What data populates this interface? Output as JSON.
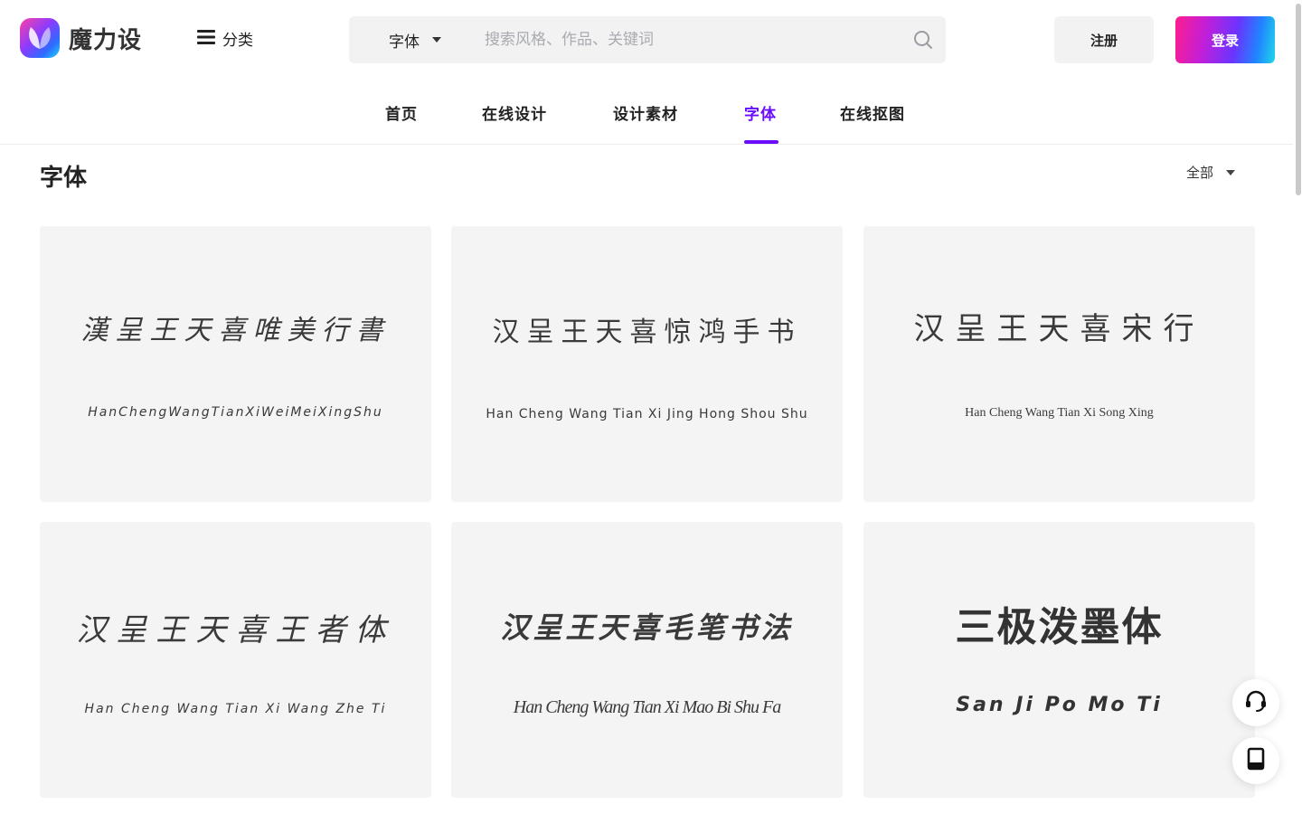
{
  "brand": {
    "name": "魔力设"
  },
  "header": {
    "category_label": "分类",
    "search": {
      "type_label": "字体",
      "placeholder": "搜索风格、作品、关键词"
    },
    "register_label": "注册",
    "login_label": "登录"
  },
  "nav": {
    "items": [
      {
        "label": "首页"
      },
      {
        "label": "在线设计"
      },
      {
        "label": "设计素材"
      },
      {
        "label": "字体",
        "active": true
      },
      {
        "label": "在线抠图"
      }
    ]
  },
  "page": {
    "title": "字体",
    "filter_label": "全部"
  },
  "fonts": [
    {
      "sample": "漢呈王天喜唯美行書",
      "name": "HanChengWangTianXiWeiMeiXingShu"
    },
    {
      "sample": "汉呈王天喜惊鸿手书",
      "name": "Han Cheng Wang Tian Xi Jing Hong Shou Shu"
    },
    {
      "sample": "汉呈王天喜宋行",
      "name": "Han Cheng Wang Tian Xi Song Xing"
    },
    {
      "sample": "汉呈王天喜王者体",
      "name": "Han Cheng Wang Tian Xi Wang Zhe Ti"
    },
    {
      "sample": "汉呈王天喜毛笔书法",
      "name": "Han Cheng Wang Tian Xi Mao Bi Shu Fa"
    },
    {
      "sample": "三极泼墨体",
      "name": "San Ji Po Mo Ti"
    }
  ],
  "colors": {
    "accent": "#6a0dff",
    "card_bg": "#f4f4f5",
    "search_bg": "#f2f2f3"
  },
  "icons": [
    "menu-icon",
    "search-icon",
    "caret-down-icon",
    "headset-icon",
    "mobile-icon"
  ]
}
